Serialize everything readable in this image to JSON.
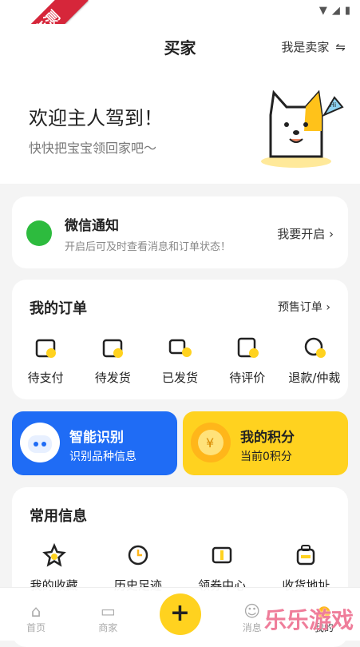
{
  "ribbon": "乐乐亲测",
  "header": {
    "title": "买家",
    "switch_label": "我是卖家"
  },
  "welcome": {
    "title": "欢迎主人驾到！",
    "subtitle": "快快把宝宝领回家吧～"
  },
  "wechat": {
    "title": "微信通知",
    "subtitle": "开启后可及时查看消息和订单状态！",
    "action": "我要开启"
  },
  "orders": {
    "title": "我的订单",
    "link": "预售订单",
    "items": [
      {
        "label": "待支付",
        "icon": "wallet-icon"
      },
      {
        "label": "待发货",
        "icon": "box-icon"
      },
      {
        "label": "已发货",
        "icon": "truck-icon"
      },
      {
        "label": "待评价",
        "icon": "review-icon"
      },
      {
        "label": "退款/仲裁",
        "icon": "refund-icon"
      }
    ]
  },
  "promo": {
    "ai": {
      "title": "智能识别",
      "subtitle": "识别品种信息"
    },
    "points": {
      "title": "我的积分",
      "subtitle": "当前0积分"
    }
  },
  "common": {
    "title": "常用信息",
    "items": [
      {
        "label": "我的收藏",
        "icon": "star-icon"
      },
      {
        "label": "历史足迹",
        "icon": "clock-icon"
      },
      {
        "label": "领券中心",
        "icon": "coupon-icon"
      },
      {
        "label": "收货地址",
        "icon": "address-icon"
      }
    ]
  },
  "tabbar": [
    {
      "label": "首页",
      "icon": "home-icon"
    },
    {
      "label": "商家",
      "icon": "shop-icon"
    },
    {
      "label": "+",
      "icon": "plus-icon"
    },
    {
      "label": "消息",
      "icon": "message-icon"
    },
    {
      "label": "我的",
      "icon": "profile-icon"
    }
  ],
  "watermark": "乐乐游戏",
  "colors": {
    "accent": "#ffd21f",
    "blue": "#1f6cf5",
    "wechat": "#2dbb3e"
  }
}
